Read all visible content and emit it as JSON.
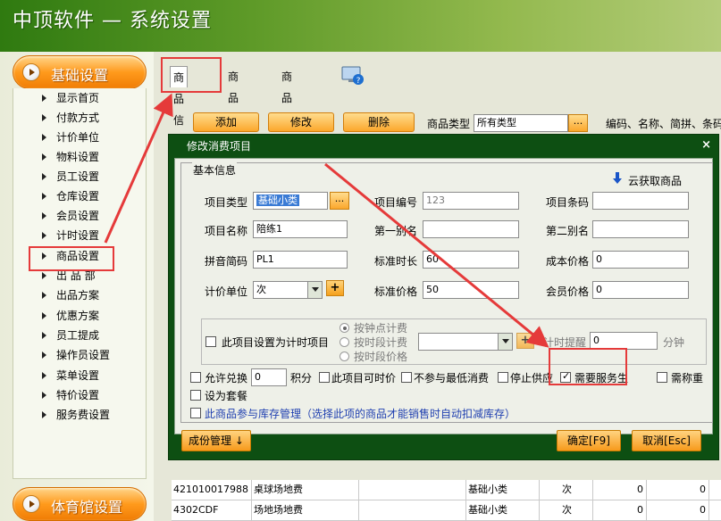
{
  "window": {
    "title": "中顶软件 — 系统设置"
  },
  "sidebar": {
    "section1": "基础设置",
    "items": [
      "显示首页",
      "付款方式",
      "计价单位",
      "物料设置",
      "员工设置",
      "仓库设置",
      "会员设置",
      "计时设置",
      "商品设置",
      "出 品 部",
      "出品方案",
      "优惠方案",
      "员工提成",
      "操作员设置",
      "菜单设置",
      "特价设置",
      "服务费设置"
    ],
    "section2": "体育馆设置"
  },
  "tabs": [
    "商品信息",
    "商品大类",
    "商品小类"
  ],
  "toolbar": {
    "add": "添加",
    "edit": "修改",
    "delete": "删除",
    "category_label": "商品类型",
    "category_value": "所有类型",
    "dots": "...",
    "hint": "编码、名称、简拼、条码"
  },
  "grid": {
    "rows": [
      {
        "code": "421010017988",
        "name": "桌球场地费",
        "type": "基础小类",
        "unit": "次",
        "v1": "0",
        "v2": "0"
      },
      {
        "code": "4302CDF",
        "name": "场地场地费",
        "type": "基础小类",
        "unit": "次",
        "v1": "0",
        "v2": "0"
      }
    ]
  },
  "dialog": {
    "title": "修改消费项目",
    "close": "×",
    "group_title": "基本信息",
    "cloud_fetch": "云获取商品",
    "fields": {
      "item_type_label": "项目类型",
      "item_type_value": "基础小类",
      "item_no_label": "项目编号",
      "item_no_value": "123",
      "barcode_label": "项目条码",
      "barcode_value": "",
      "name_label": "项目名称",
      "name_value": "陪练1",
      "alias1_label": "第一别名",
      "alias1_value": "",
      "alias2_label": "第二别名",
      "alias2_value": "",
      "pinyin_label": "拼音简码",
      "pinyin_value": "PL1",
      "std_duration_label": "标准时长",
      "std_duration_value": "60",
      "cost_price_label": "成本价格",
      "cost_price_value": "0",
      "unit_label": "计价单位",
      "unit_value": "次",
      "std_price_label": "标准价格",
      "std_price_value": "50",
      "member_price_label": "会员价格",
      "member_price_value": "0"
    },
    "timer": {
      "checkbox_label": "此项目设置为计时项目",
      "radio1": "按钟点计费",
      "radio2": "按时段计费",
      "radio3": "按时段价格",
      "reminder_label": "计时提醒",
      "reminder_value": "0",
      "minute_unit": "分钟"
    },
    "options": {
      "allow_exchange": "允许兑换",
      "exchange_value": "0",
      "points_unit": "积分",
      "time_price": "此项目可时价",
      "no_min_spend": "不参与最低消费",
      "stop_supply": "停止供应",
      "need_staff": "需要服务生",
      "need_weigh": "需称重",
      "set_combo": "设为套餐",
      "inventory": "此商品参与库存管理（选择此项的商品才能销售时自动扣减库存）"
    },
    "buttons": {
      "ingredients": "成份管理",
      "confirm": "确定[F9]",
      "cancel": "取消[Esc]"
    }
  },
  "colors": {
    "banner": "#3f8a18",
    "dialog_frame": "#0d4f12",
    "orange": "#fba72c",
    "highlight": "#e53a3a"
  }
}
